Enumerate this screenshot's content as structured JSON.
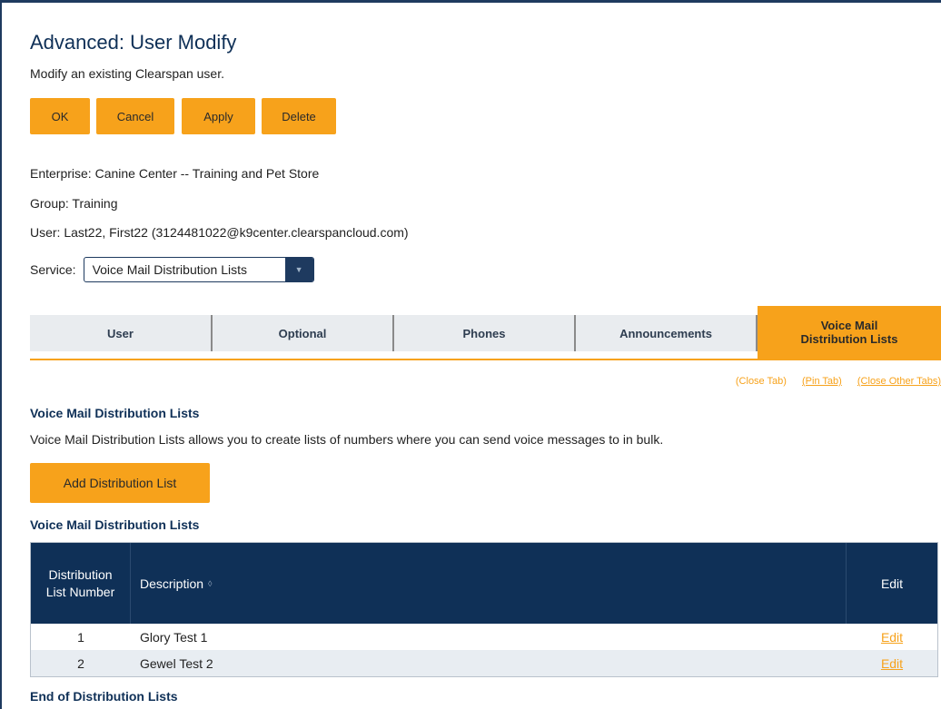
{
  "header": {
    "title": "Advanced: User Modify",
    "subtitle": "Modify an existing Clearspan user."
  },
  "actions": {
    "ok": "OK",
    "cancel": "Cancel",
    "apply": "Apply",
    "delete": "Delete"
  },
  "context": {
    "enterprise": "Enterprise:  Canine Center -- Training and Pet Store",
    "group": "Group:  Training",
    "user": "User:  Last22, First22 (3124481022@k9center.clearspancloud.com)"
  },
  "service": {
    "label": "Service:",
    "selected": "Voice Mail Distribution Lists"
  },
  "tabs": [
    {
      "label": "User",
      "active": false
    },
    {
      "label": "Optional",
      "active": false
    },
    {
      "label": "Phones",
      "active": false
    },
    {
      "label": "Announcements",
      "active": false
    },
    {
      "label": "Voice Mail Distribution Lists",
      "active": true
    }
  ],
  "tab_links": {
    "close_tab": "(Close Tab)",
    "pin_tab": "(Pin Tab)",
    "close_other_tabs": "(Close Other Tabs)"
  },
  "section": {
    "title": "Voice Mail Distribution Lists",
    "description": "Voice Mail Distribution Lists allows you to create lists of numbers where you can send voice messages to in bulk.",
    "add_button": "Add Distribution List",
    "table_title": "Voice Mail Distribution Lists",
    "footer": "End of Distribution Lists"
  },
  "table": {
    "columns": {
      "number": "Distribution List Number",
      "description": "Description",
      "edit": "Edit"
    },
    "rows": [
      {
        "number": "1",
        "description": "Glory Test 1",
        "edit": "Edit"
      },
      {
        "number": "2",
        "description": "Gewel Test 2",
        "edit": "Edit"
      }
    ]
  },
  "colors": {
    "accent": "#f7a21b",
    "navy": "#0f3057",
    "tab_bg": "#e9ecef"
  }
}
